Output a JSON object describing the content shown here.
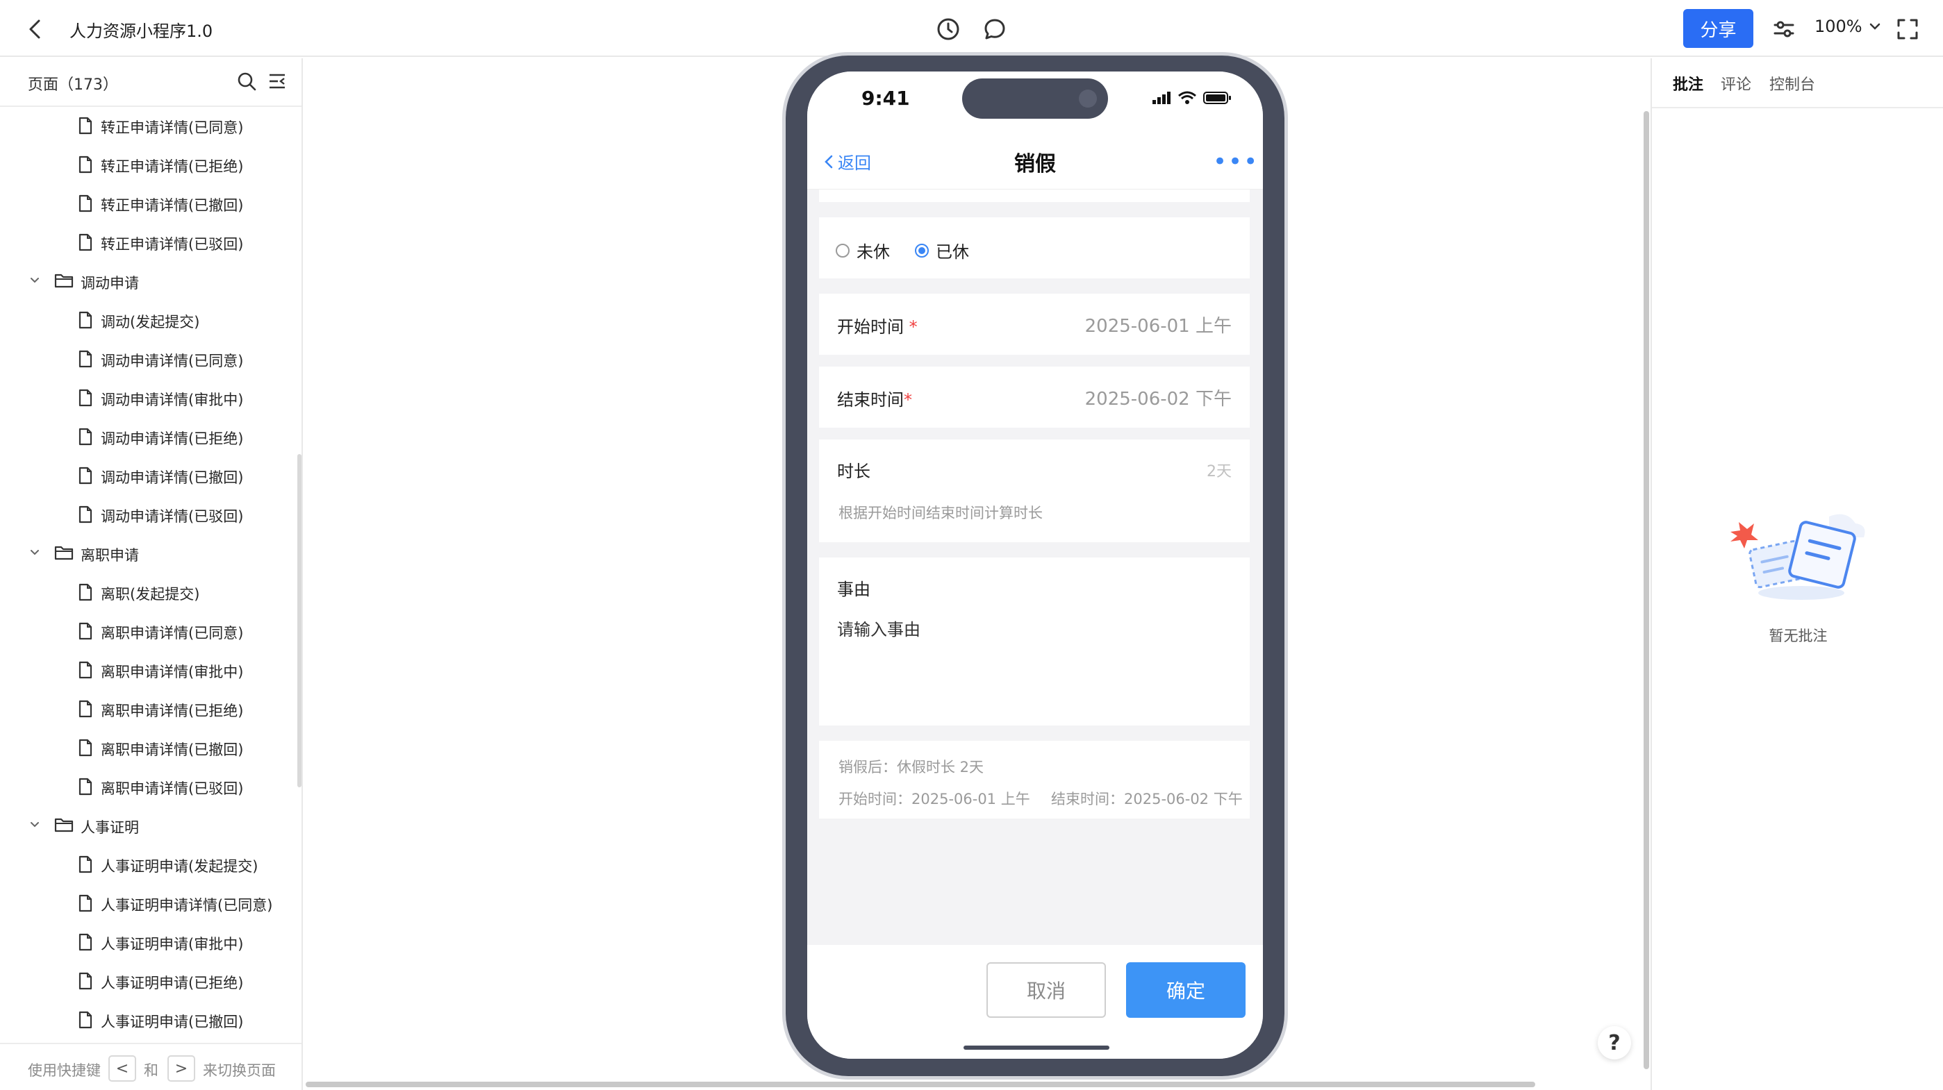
{
  "app": {
    "title": "人力资源小程序1.0",
    "share_label": "分享",
    "zoom": "100%"
  },
  "sidebar": {
    "pages_title": "页面（173）",
    "items": [
      {
        "type": "page",
        "label": "转正申请详情(已同意)"
      },
      {
        "type": "page",
        "label": "转正申请详情(已拒绝)"
      },
      {
        "type": "page",
        "label": "转正申请详情(已撤回)"
      },
      {
        "type": "page",
        "label": "转正申请详情(已驳回)"
      },
      {
        "type": "folder",
        "label": "调动申请"
      },
      {
        "type": "page",
        "label": "调动(发起提交)"
      },
      {
        "type": "page",
        "label": "调动申请详情(已同意)"
      },
      {
        "type": "page",
        "label": "调动申请详情(审批中)"
      },
      {
        "type": "page",
        "label": "调动申请详情(已拒绝)"
      },
      {
        "type": "page",
        "label": "调动申请详情(已撤回)"
      },
      {
        "type": "page",
        "label": "调动申请详情(已驳回)"
      },
      {
        "type": "folder",
        "label": "离职申请"
      },
      {
        "type": "page",
        "label": "离职(发起提交)"
      },
      {
        "type": "page",
        "label": "离职申请详情(已同意)"
      },
      {
        "type": "page",
        "label": "离职申请详情(审批中)"
      },
      {
        "type": "page",
        "label": "离职申请详情(已拒绝)"
      },
      {
        "type": "page",
        "label": "离职申请详情(已撤回)"
      },
      {
        "type": "page",
        "label": "离职申请详情(已驳回)"
      },
      {
        "type": "folder",
        "label": "人事证明"
      },
      {
        "type": "page",
        "label": "人事证明申请(发起提交)"
      },
      {
        "type": "page",
        "label": "人事证明申请详情(已同意)"
      },
      {
        "type": "page",
        "label": "人事证明申请(审批中)"
      },
      {
        "type": "page",
        "label": "人事证明申请(已拒绝)"
      },
      {
        "type": "page",
        "label": "人事证明申请(已撤回)"
      }
    ],
    "footer": {
      "prefix": "使用快捷键",
      "key_prev": "<",
      "and": "和",
      "key_next": ">",
      "suffix": "来切换页面"
    }
  },
  "phone": {
    "time": "9:41",
    "nav": {
      "back": "返回",
      "title": "销假",
      "more": "•••"
    },
    "radio": {
      "option_1": "未休",
      "option_2": "已休",
      "selected": "已休"
    },
    "start": {
      "label": "开始时间",
      "required": "*",
      "value": "2025-06-01 上午"
    },
    "end": {
      "label": "结束时间",
      "required": "*",
      "value": "2025-06-02 下午"
    },
    "duration": {
      "label": "时长",
      "value": "2天",
      "hint": "根据开始时间结束时间计算时长"
    },
    "reason": {
      "label": "事由",
      "placeholder": "请输入事由"
    },
    "summary": {
      "line1": "销假后：休假时长 2天",
      "start": "开始时间：2025-06-01 上午",
      "end": "结束时间：2025-06-02 下午"
    },
    "buttons": {
      "cancel": "取消",
      "confirm": "确定"
    }
  },
  "right_panel": {
    "tabs": [
      "批注",
      "评论",
      "控制台"
    ],
    "active_tab": "批注",
    "empty_text": "暂无批注"
  },
  "help": "?",
  "colors": {
    "accent": "#2a6df4",
    "phone_blue": "#3d94f6",
    "phone_frame": "#474c5c",
    "required": "#f04040"
  }
}
